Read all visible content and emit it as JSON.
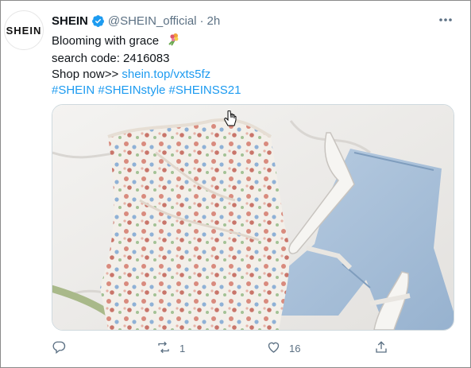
{
  "tweet": {
    "avatar_text": "SHEIN",
    "name": "SHEIN",
    "handle": "@SHEIN_official",
    "separator": "·",
    "time": "2h",
    "line1": "Blooming with grace",
    "line2": "search code: 2416083",
    "line3_prefix": "Shop now>> ",
    "line3_link": "shein.top/vxts5fz",
    "hashtags": "#SHEIN #SHEINstyle #SHEINSS21"
  },
  "actions": {
    "reply_icon": "reply-icon",
    "retweet_count": "1",
    "like_count": "16",
    "share_icon": "share-icon"
  },
  "colors": {
    "link": "#1d9bf0",
    "muted": "#5b7083",
    "verified": "#1d9bf0",
    "sheet": "#ecebe8",
    "denim": "#a9c2da"
  }
}
